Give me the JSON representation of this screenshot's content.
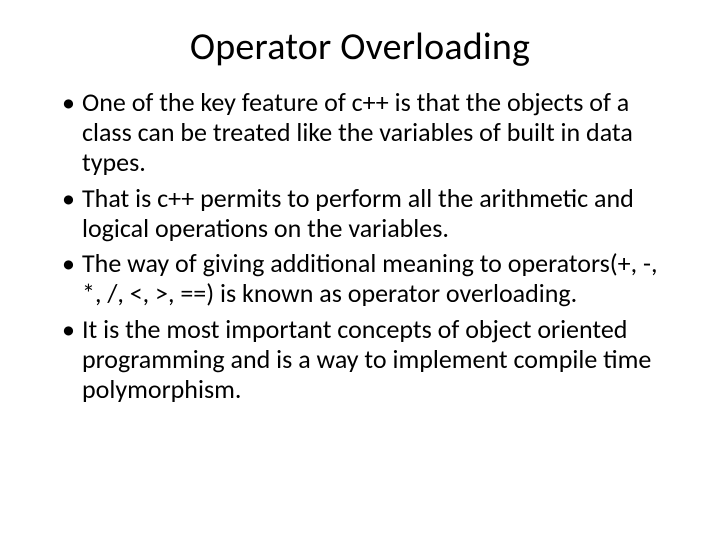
{
  "slide": {
    "title": "Operator Overloading",
    "bullets": [
      "One of the key feature of c++ is that the objects of a class can be treated like the variables of built in data types.",
      "That is c++ permits to perform all the arithmetic and logical operations on the variables.",
      "The way of giving additional meaning to operators(+, -, *, /, <, >, ==) is known as operator overloading.",
      "It is the most important concepts of object oriented programming and is a way to implement compile time polymorphism."
    ]
  }
}
